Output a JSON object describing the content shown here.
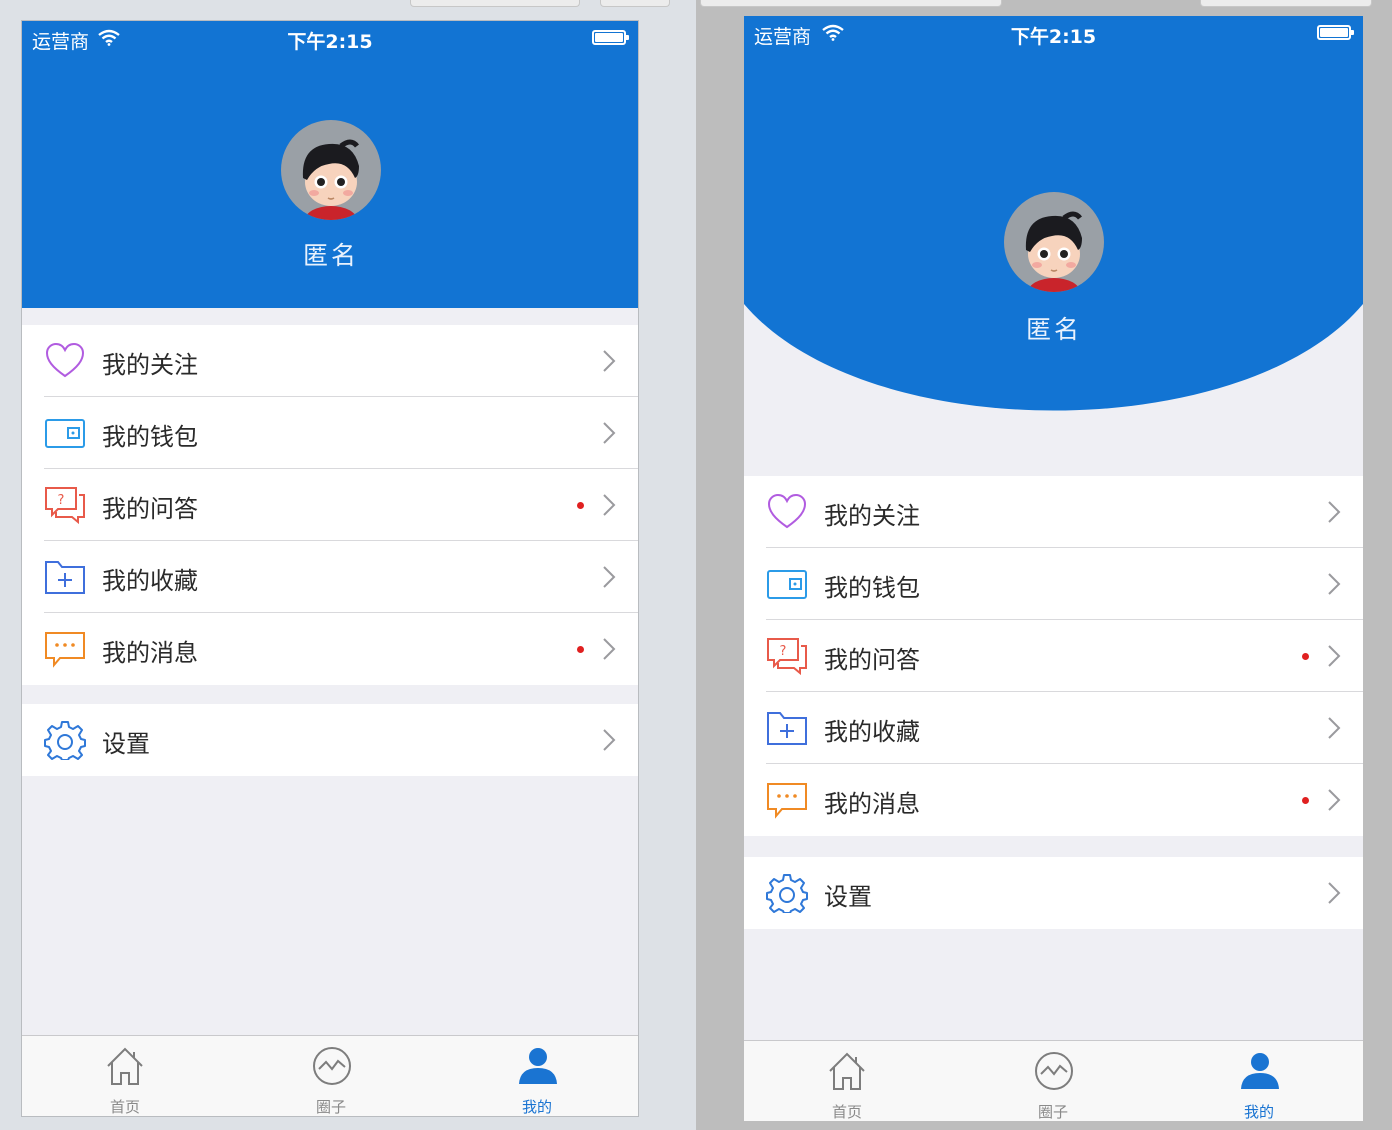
{
  "status_bar": {
    "carrier": "运营商",
    "time": "下午2:15"
  },
  "profile": {
    "name": "匿名"
  },
  "menu": [
    {
      "label": "我的关注",
      "icon": "heart-icon",
      "badge": false
    },
    {
      "label": "我的钱包",
      "icon": "wallet-icon",
      "badge": false
    },
    {
      "label": "我的问答",
      "icon": "question-chat-icon",
      "badge": true
    },
    {
      "label": "我的收藏",
      "icon": "folder-plus-icon",
      "badge": false
    },
    {
      "label": "我的消息",
      "icon": "message-dots-icon",
      "badge": true
    }
  ],
  "settings": {
    "label": "设置",
    "icon": "gear-icon"
  },
  "tabbar": [
    {
      "label": "首页",
      "icon": "home-icon"
    },
    {
      "label": "圈子",
      "icon": "pulse-circle-icon"
    },
    {
      "label": "我的",
      "icon": "user-icon",
      "active": true
    }
  ],
  "colors": {
    "brand_blue": "#1274d3",
    "badge_red": "#e02020",
    "heart": "#b15ce0",
    "wallet": "#2b9be8",
    "question": "#e85a4a",
    "folder": "#3f6fdc",
    "message": "#f08a24",
    "gear": "#2f78d8"
  }
}
